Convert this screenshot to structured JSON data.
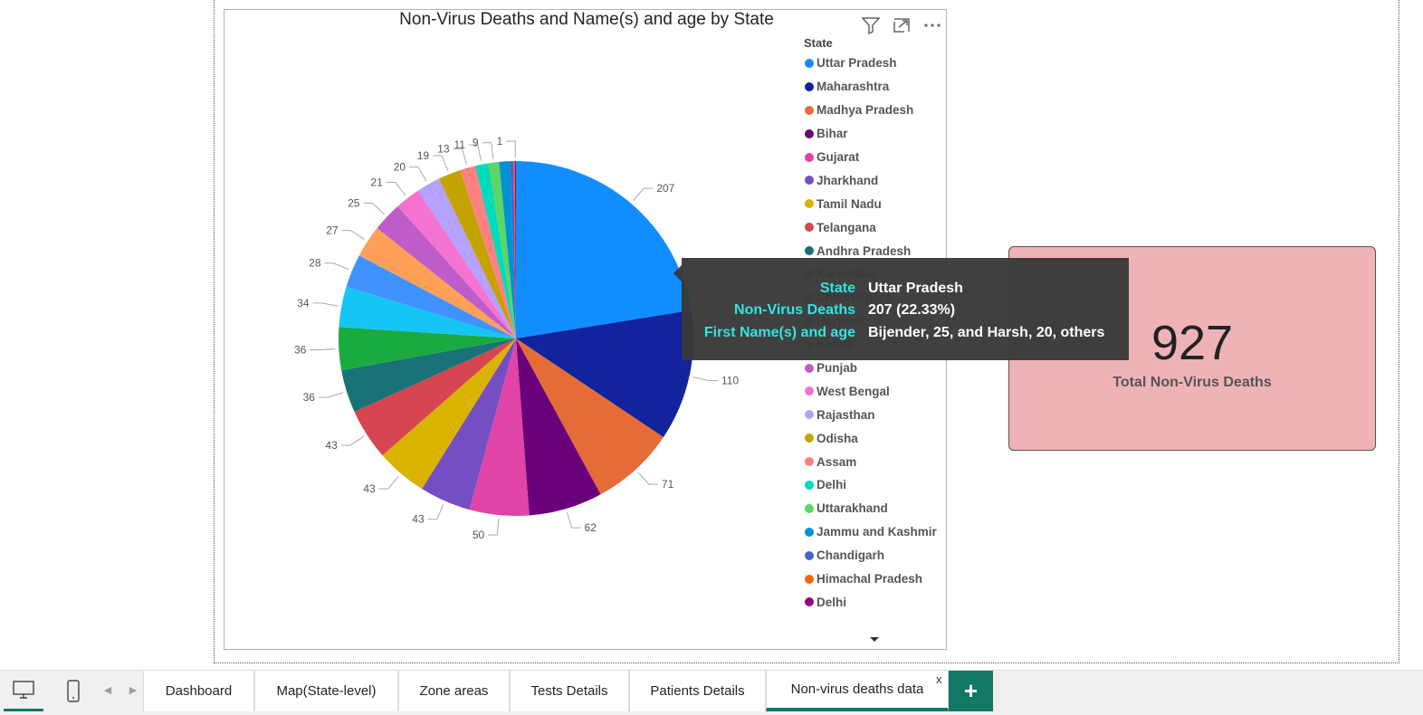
{
  "visual": {
    "title": "Non-Virus Deaths and Name(s) and age by State",
    "icons": [
      "filter-icon",
      "focus-mode-icon",
      "more-options-icon"
    ]
  },
  "legend": {
    "title": "State",
    "placement": "right"
  },
  "chart_data": {
    "type": "pie",
    "title": "Non-Virus Deaths and Name(s) and age by State",
    "legend_title": "State",
    "categories": [
      "Uttar Pradesh",
      "Maharashtra",
      "Madhya Pradesh",
      "Bihar",
      "Gujarat",
      "Jharkhand",
      "Tamil Nadu",
      "Telangana",
      "Andhra Pradesh",
      "Karnataka",
      "Chhattisgarh",
      "Haryana",
      "Kerala",
      "Punjab",
      "West Bengal",
      "Rajasthan",
      "Odisha",
      "Assam",
      "Delhi",
      "Uttarakhand",
      "Jammu and Kashmir",
      "Chandigarh",
      "Himachal Pradesh",
      "Delhi"
    ],
    "values": [
      207,
      110,
      71,
      62,
      50,
      43,
      43,
      43,
      36,
      36,
      34,
      28,
      27,
      25,
      21,
      20,
      19,
      13,
      11,
      9,
      9,
      3,
      1,
      1
    ],
    "data_labels": [
      "207",
      "110",
      "71",
      "62",
      "50",
      "43",
      "43",
      "43",
      "36",
      "36",
      "34",
      "28",
      "27",
      "25",
      "21",
      "20",
      "19",
      "13",
      "11",
      "9",
      "",
      "",
      "",
      "1"
    ],
    "colors": [
      "#118dff",
      "#12239e",
      "#e66c37",
      "#6b007b",
      "#e044a7",
      "#744ec2",
      "#d9b300",
      "#d64550",
      "#197278",
      "#1aab40",
      "#15c6f4",
      "#4092ff",
      "#ffa058",
      "#be5dc9",
      "#f472d0",
      "#b5a1ff",
      "#c4a200",
      "#ff8080",
      "#00dbbc",
      "#5bd667",
      "#0091d5",
      "#4668c5",
      "#ff6300",
      "#99008a"
    ]
  },
  "tooltip": {
    "rows": [
      {
        "key": "State",
        "value": "Uttar Pradesh"
      },
      {
        "key": "Non-Virus Deaths",
        "value": "207 (22.33%)"
      },
      {
        "key": "First Name(s) and age",
        "value": "Bijender, 25, and Harsh, 20, others"
      }
    ]
  },
  "card": {
    "value": "927",
    "label": "Total Non-Virus Deaths",
    "color": "#efb3b7"
  },
  "bottom_bar": {
    "tabs": [
      "Dashboard",
      "Map(State-level)",
      "Zone areas",
      "Tests Details",
      "Patients Details",
      "Non-virus deaths data"
    ],
    "active_tab": "Non-virus deaths data",
    "close_label": "x",
    "add_label": "+",
    "accent": "#117865"
  }
}
